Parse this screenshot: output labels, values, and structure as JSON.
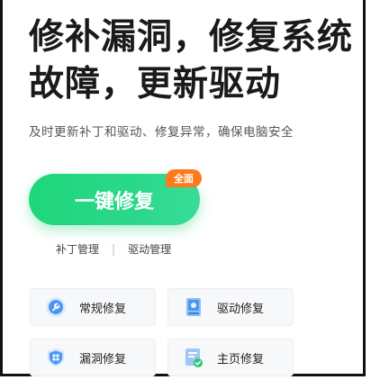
{
  "hero": {
    "title_line1": "修补漏洞，修复系统",
    "title_line2": "故障，更新驱动",
    "subtitle": "及时更新补丁和驱动、修复异常，确保电脑安全"
  },
  "main_button": {
    "label": "一键修复",
    "badge": "全面"
  },
  "links": {
    "patch": "补丁管理",
    "separator": "|",
    "driver": "驱动管理"
  },
  "tools": [
    {
      "label": "常规修复",
      "icon": "wrench-icon"
    },
    {
      "label": "驱动修复",
      "icon": "driver-chip-icon"
    },
    {
      "label": "漏洞修复",
      "icon": "shield-windows-icon"
    },
    {
      "label": "主页修复",
      "icon": "homepage-document-icon"
    }
  ],
  "colors": {
    "accent_green": "#1fd67a",
    "badge_orange": "#ff7a1a",
    "icon_blue": "#3b8cf0"
  }
}
